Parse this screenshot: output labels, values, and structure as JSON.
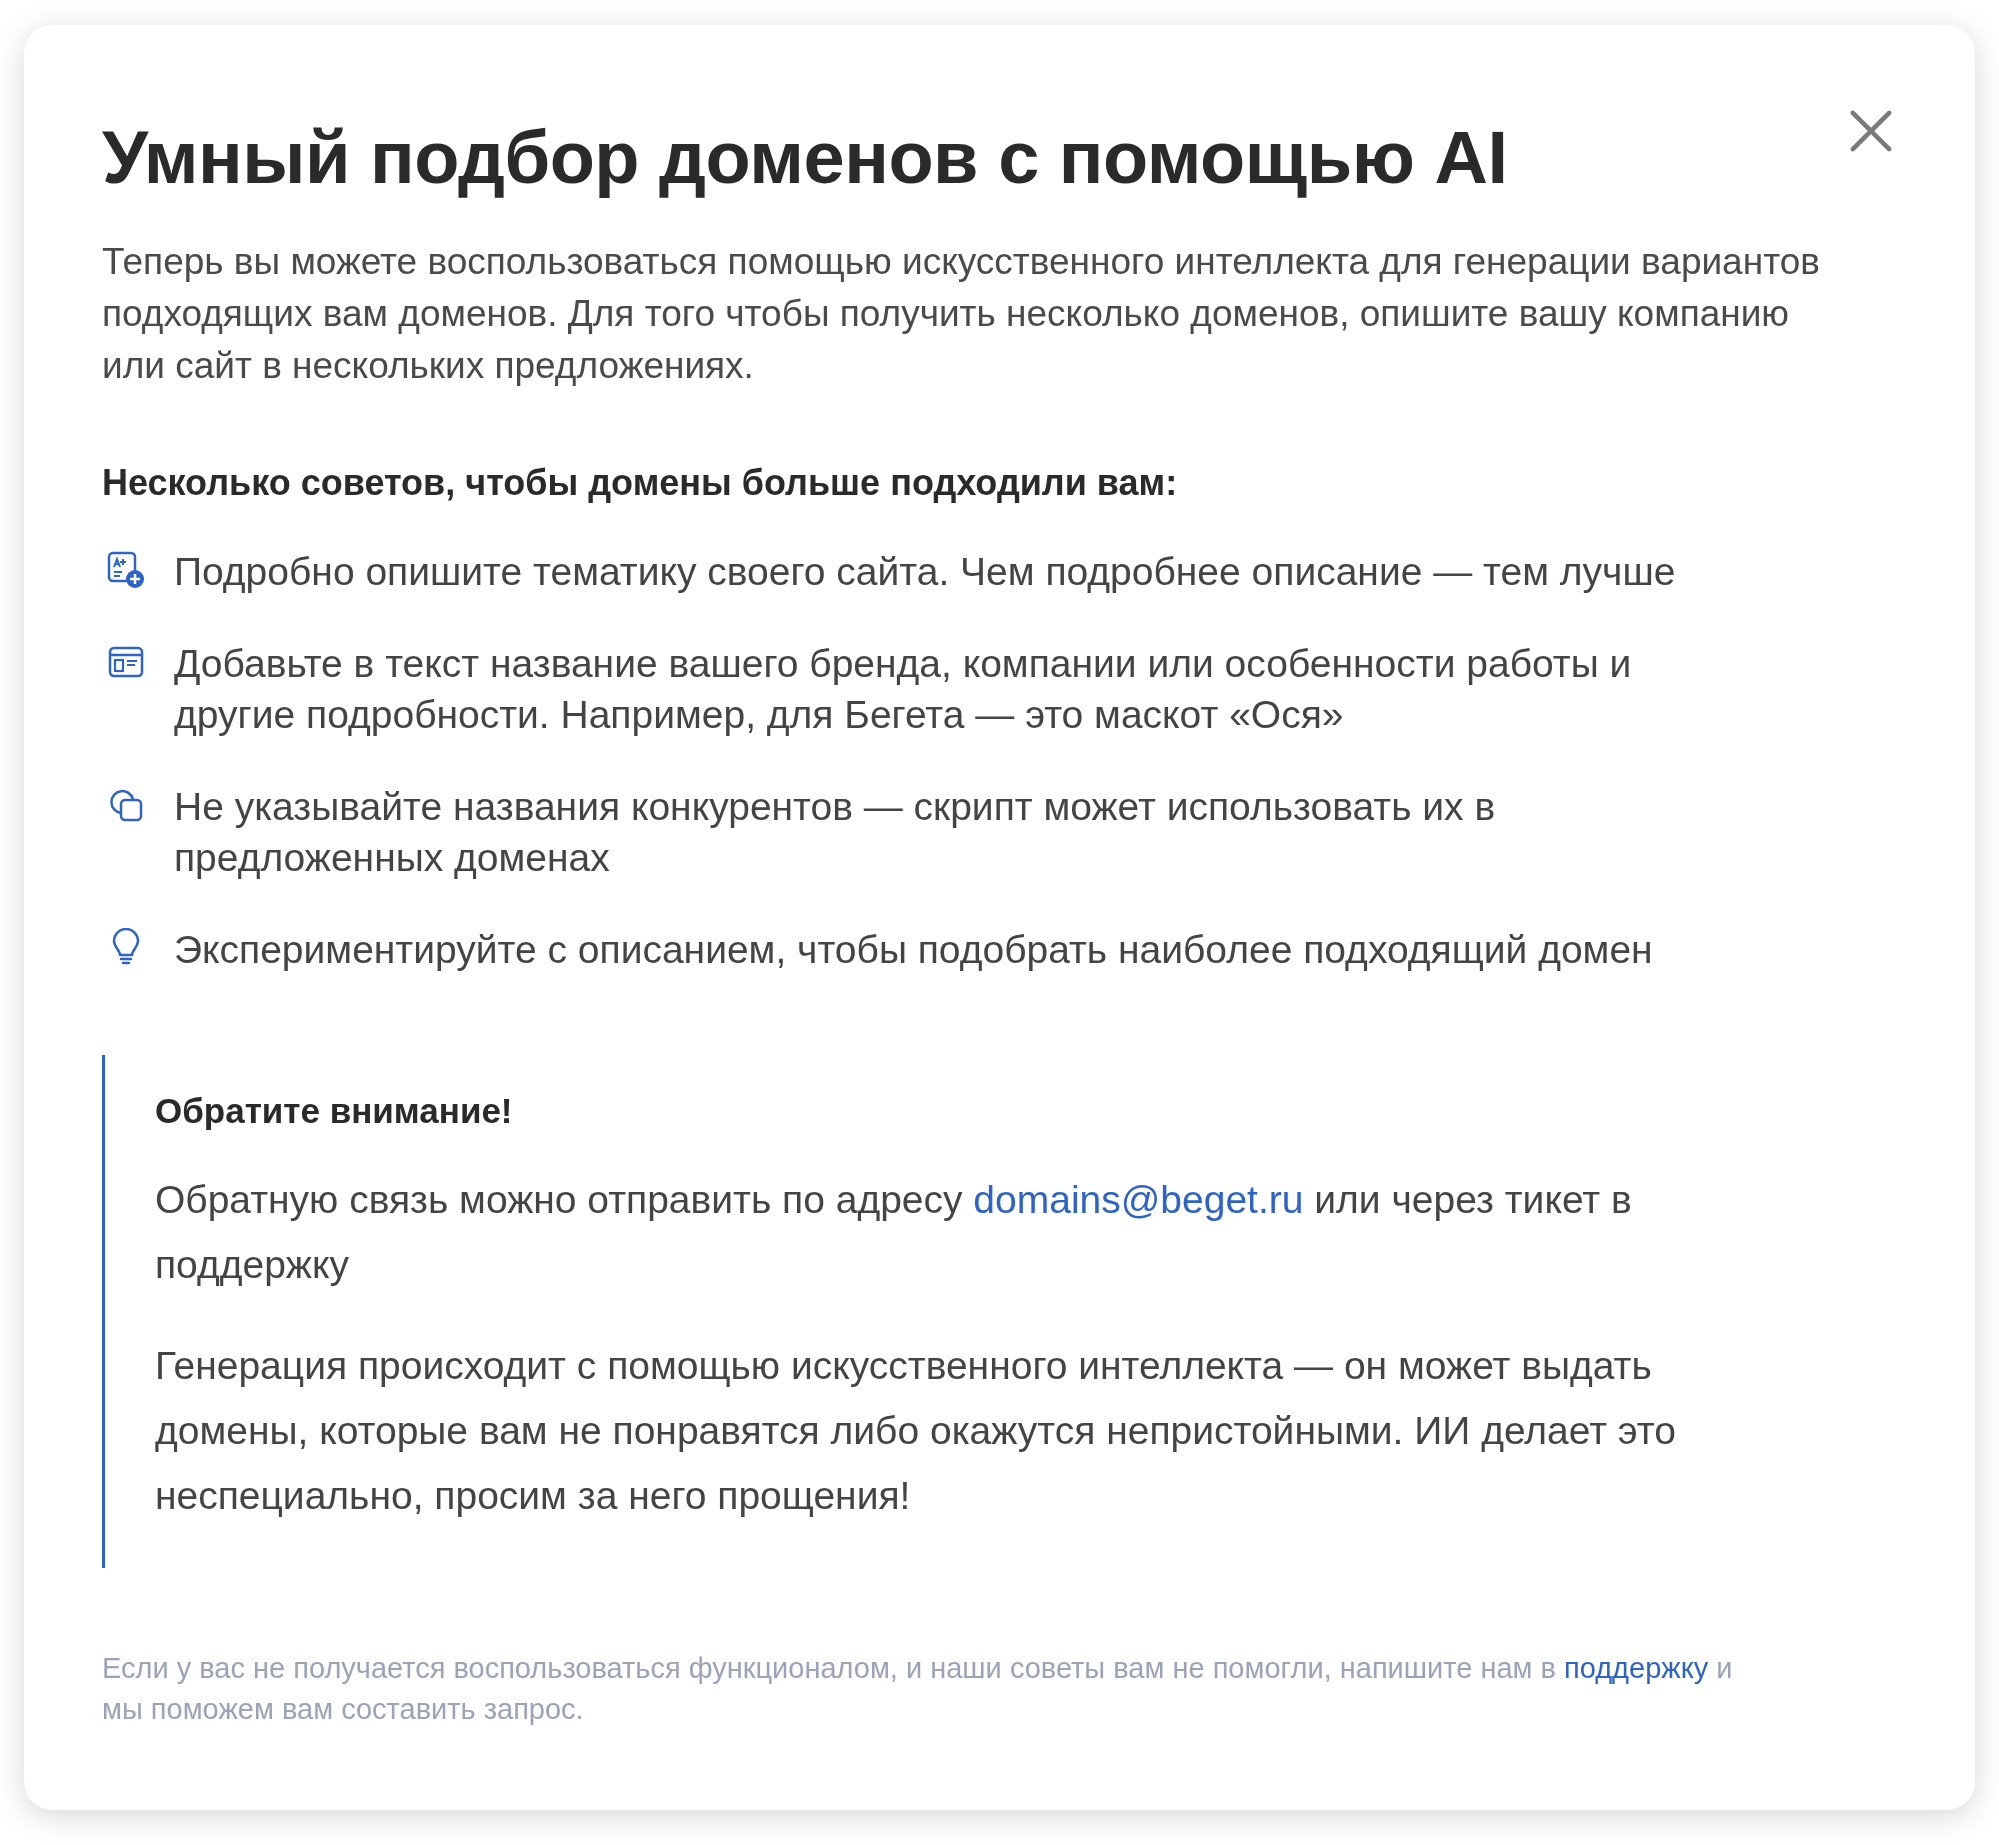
{
  "dialog": {
    "title": "Умный подбор доменов с помощью AI",
    "intro": "Теперь вы можете воспользоваться помощью искусственного интеллекта для генерации вариантов подходящих вам доменов. Для того чтобы получить несколько доменов, опишите вашу компанию или сайт в нескольких предложениях.",
    "tips_heading": "Несколько советов, чтобы домены больше подходили вам:",
    "tips": [
      {
        "kind": "text-add",
        "text": "Подробно опишите тематику своего сайта. Чем подробнее описание — тем лучше"
      },
      {
        "kind": "window",
        "text": "Добавьте в текст название вашего бренда, компании или особенности работы и другие подробности. Например, для Бегета — это маскот «Ося»"
      },
      {
        "kind": "shapes",
        "text": "Не указывайте названия конкурентов — скрипт может использовать их в предложенных доменах"
      },
      {
        "kind": "bulb",
        "text": "Экспериментируйте с описанием, чтобы подобрать наиболее подходящий домен"
      }
    ],
    "notice": {
      "heading": "Обратите внимание!",
      "paragraphs": [
        [
          {
            "kind": "text",
            "text": "Обратную связь можно отправить по адресу "
          },
          {
            "kind": "link",
            "text": "domains@beget.ru"
          },
          {
            "kind": "text",
            "text": " или через тикет в поддержку"
          }
        ],
        [
          {
            "kind": "text",
            "text": "Генерация происходит с помощью искусственного интеллекта — он может выдать домены, которые вам не понравятся либо окажутся непристойными. ИИ делает это неспециально, просим за него прощения!"
          }
        ]
      ]
    },
    "footer": [
      {
        "kind": "text",
        "text": "Если у вас не получается воспользоваться функционалом, и наши советы вам не помогли, напишите нам в "
      },
      {
        "kind": "link",
        "text": "поддержку"
      },
      {
        "kind": "text",
        "text": " и мы поможем вам составить запрос."
      }
    ]
  }
}
